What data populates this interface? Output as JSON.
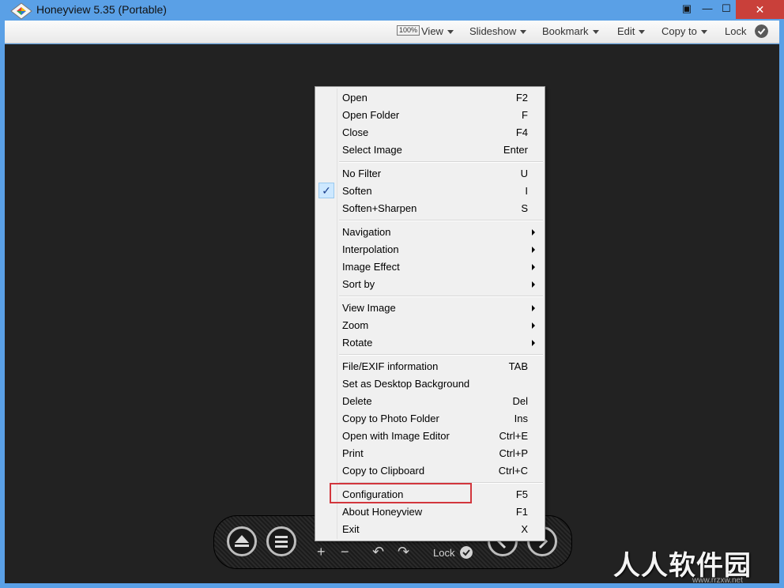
{
  "window": {
    "title": "Honeyview 5.35 (Portable)",
    "controls": [
      "▣",
      "—",
      "☐",
      "✕"
    ]
  },
  "toolbar": {
    "zoom_badge": "100%",
    "items": [
      "View",
      "Slideshow",
      "Bookmark",
      "Edit",
      "Copy to",
      "Lock"
    ]
  },
  "context_menu": {
    "items": [
      {
        "label": "Open",
        "shortcut": "F2"
      },
      {
        "label": "Open Folder",
        "shortcut": "F"
      },
      {
        "label": "Close",
        "shortcut": "F4"
      },
      {
        "label": "Select Image",
        "shortcut": "Enter"
      },
      {
        "label": "No Filter",
        "shortcut": "U"
      },
      {
        "label": "Soften",
        "shortcut": "I",
        "checked": true
      },
      {
        "label": "Soften+Sharpen",
        "shortcut": "S"
      },
      {
        "label": "Navigation",
        "submenu": true
      },
      {
        "label": "Interpolation",
        "submenu": true
      },
      {
        "label": "Image Effect",
        "submenu": true
      },
      {
        "label": "Sort by",
        "submenu": true
      },
      {
        "label": "View Image",
        "submenu": true
      },
      {
        "label": "Zoom",
        "submenu": true
      },
      {
        "label": "Rotate",
        "submenu": true
      },
      {
        "label": "File/EXIF information",
        "shortcut": "TAB"
      },
      {
        "label": "Set as Desktop Background",
        "shortcut": ""
      },
      {
        "label": "Delete",
        "shortcut": "Del"
      },
      {
        "label": "Copy to Photo Folder",
        "shortcut": "Ins"
      },
      {
        "label": "Open with Image Editor",
        "shortcut": "Ctrl+E"
      },
      {
        "label": "Print",
        "shortcut": "Ctrl+P"
      },
      {
        "label": "Copy to Clipboard",
        "shortcut": "Ctrl+C"
      },
      {
        "label": "Configuration",
        "shortcut": "F5",
        "highlighted": true
      },
      {
        "label": "About Honeyview",
        "shortcut": "F1"
      },
      {
        "label": "Exit",
        "shortcut": "X"
      }
    ],
    "check_glyph": "✓"
  },
  "bottom_bar": {
    "plus": "+",
    "minus": "−",
    "rotate_left": "↶",
    "rotate_right": "↷",
    "lock_label": "Lock"
  },
  "watermark": {
    "text": "人人软件园",
    "url": "www.rrzxw.net"
  },
  "icons": [
    "app-logo-icon",
    "eject-icon",
    "menu-icon",
    "prev-icon",
    "next-icon",
    "lock-check-icon"
  ]
}
